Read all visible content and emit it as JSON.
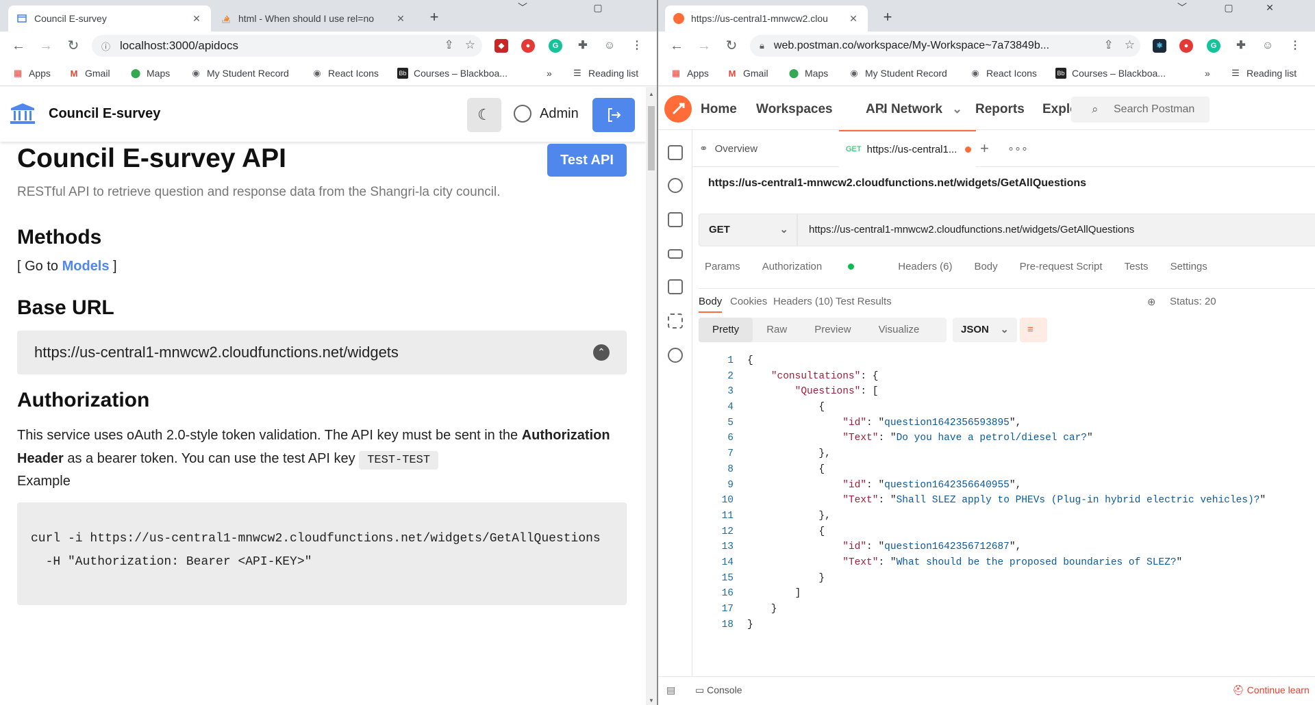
{
  "left_window": {
    "tabs": [
      {
        "title": "Council E-survey",
        "close": "✕"
      },
      {
        "title": "html - When should I use rel=no",
        "close": "✕"
      }
    ],
    "new_tab": "+",
    "controls": {
      "minimize": "﹀",
      "restore": "▢",
      "close": "✕"
    },
    "address": "localhost:3000/apidocs",
    "bookmarks": [
      "Apps",
      "Gmail",
      "Maps",
      "My Student Record",
      "React Icons",
      "Courses – Blackboa..."
    ],
    "bookmarks_more": "»",
    "reading_list": "Reading list"
  },
  "app": {
    "title": "Council E-survey",
    "user": "Admin",
    "page_title": "Council E-survey API",
    "test_api_button": "Test API",
    "description": "RESTful API to retrieve question and response data from the Shangri-la city council.",
    "methods_heading": "Methods",
    "goto_prefix": "[ Go to ",
    "goto_link": "Models",
    "goto_suffix": " ]",
    "base_url_heading": "Base URL",
    "base_url": "https://us-central1-mnwcw2.cloudfunctions.net/widgets",
    "auth_heading": "Authorization",
    "auth_text_1": "This service uses oAuth 2.0-style token validation. The API key must be sent in the ",
    "auth_bold_1": "Authorization Header",
    "auth_text_2": " as a bearer token. You can use the test API key ",
    "auth_key": "TEST-TEST",
    "example_label": "Example",
    "code_line_1": "curl -i https://us-central1-mnwcw2.cloudfunctions.net/widgets/GetAllQuestions",
    "code_line_2": "  -H \"Authorization: Bearer <API-KEY>\""
  },
  "right_window": {
    "tab_title": "https://us-central1-mnwcw2.clou",
    "tab_close": "✕",
    "new_tab": "+",
    "controls": {
      "minimize": "﹀",
      "restore": "▢",
      "close": "✕"
    },
    "address": "web.postman.co/workspace/My-Workspace~7a73849b...",
    "bookmarks": [
      "Apps",
      "Gmail",
      "Maps",
      "My Student Record",
      "React Icons",
      "Courses – Blackboa..."
    ],
    "bookmarks_more": "»",
    "reading_list": "Reading list"
  },
  "postman": {
    "nav": [
      "Home",
      "Workspaces",
      "API Network",
      "Reports",
      "Explo"
    ],
    "search_placeholder": "Search Postman",
    "tab_overview": "Overview",
    "tab_method": "GET",
    "tab_request": "https://us-central1...",
    "request_title": "https://us-central1-mnwcw2.cloudfunctions.net/widgets/GetAllQuestions",
    "method": "GET",
    "url": "https://us-central1-mnwcw2.cloudfunctions.net/widgets/GetAllQuestions",
    "request_tabs": [
      "Params",
      "Authorization",
      "Headers (6)",
      "Body",
      "Pre-request Script",
      "Tests",
      "Settings"
    ],
    "response_tabs": [
      "Body",
      "Cookies",
      "Headers (10)",
      "Test Results"
    ],
    "status": "Status: 20",
    "view_modes": [
      "Pretty",
      "Raw",
      "Preview",
      "Visualize"
    ],
    "format": "JSON",
    "line_numbers": [
      "1",
      "2",
      "3",
      "4",
      "5",
      "6",
      "7",
      "8",
      "9",
      "10",
      "11",
      "12",
      "13",
      "14",
      "15",
      "16",
      "17",
      "18"
    ],
    "questions": [
      {
        "id": "question1642356593895",
        "text": "Do you have a petrol/diesel car?"
      },
      {
        "id": "question1642356640955",
        "text": "Shall SLEZ apply to PHEVs (Plug-in hybrid electric vehicles)?"
      },
      {
        "id": "question1642356712687",
        "text": "What should be the proposed boundaries of SLEZ?"
      }
    ],
    "json_keys": {
      "consultations": "\"consultations\"",
      "questions": "\"Questions\"",
      "id": "\"id\"",
      "text": "\"Text\""
    },
    "console": "Console",
    "continue": "Continue learn"
  }
}
